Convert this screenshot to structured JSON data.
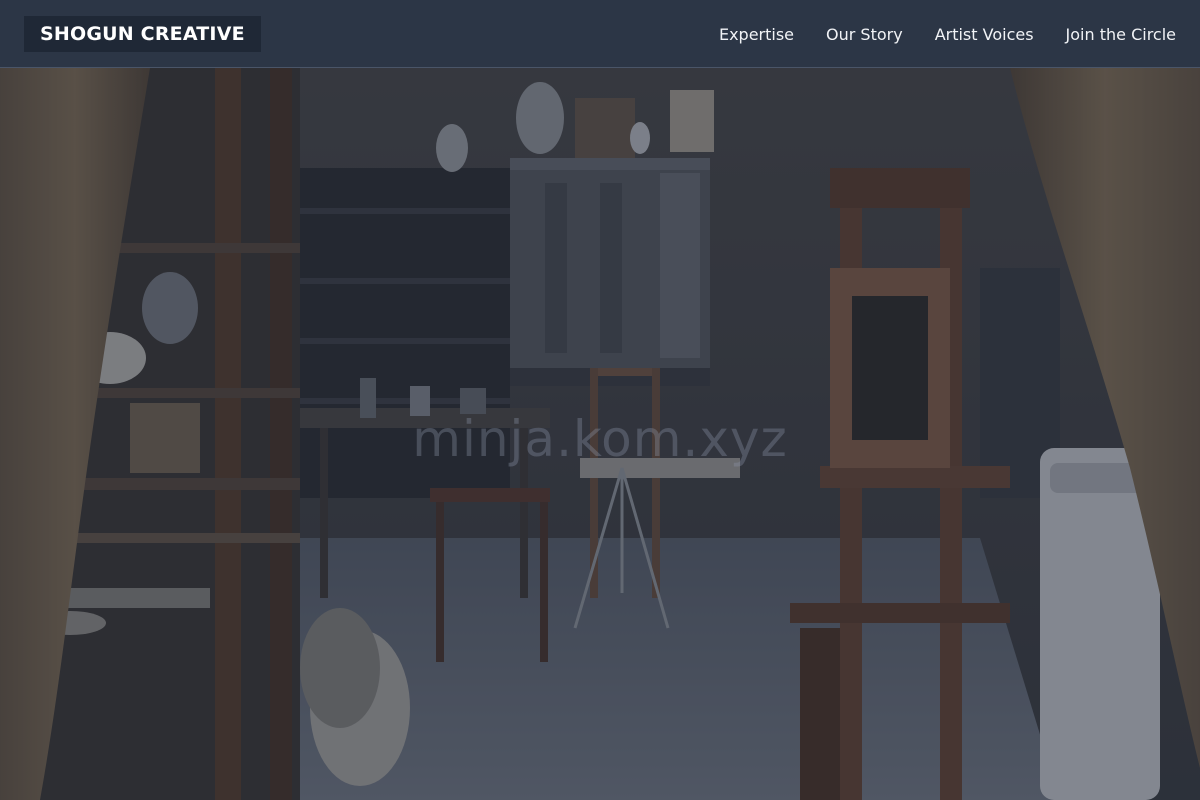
{
  "brand": {
    "name": "SHOGUN CREATIVE"
  },
  "nav": {
    "links": [
      {
        "label": "Expertise"
      },
      {
        "label": "Our Story"
      },
      {
        "label": "Artist Voices"
      },
      {
        "label": "Join the Circle"
      }
    ]
  },
  "hero": {
    "image_icon": "artist-studio-photo",
    "watermark": "minja.kom.xyz"
  },
  "colors": {
    "navbar_bg": "#2c3646",
    "brand_bg": "#1f2836",
    "nav_text": "#f1f3f6",
    "overlay": "#1c2433"
  }
}
